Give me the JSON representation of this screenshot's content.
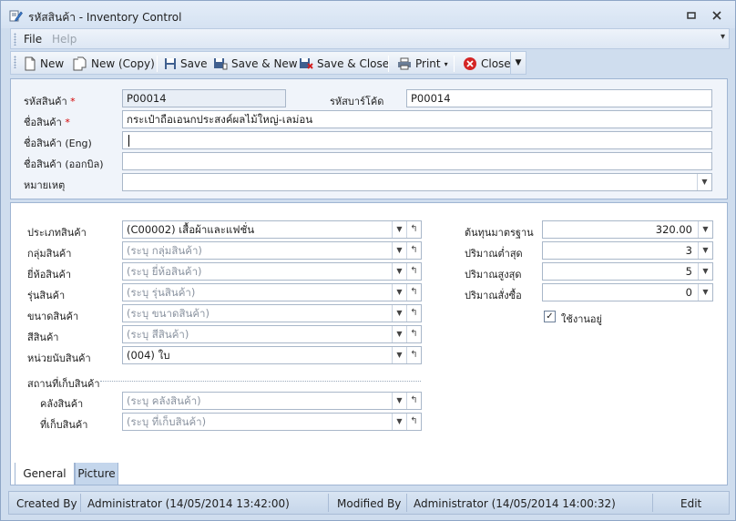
{
  "window": {
    "title": "รหัสสินค้า - Inventory Control",
    "controls": [
      "restore-icon",
      "close-icon"
    ]
  },
  "menu": {
    "file": "File",
    "help": "Help"
  },
  "toolbar": {
    "new": "New",
    "new_copy": "New (Copy)",
    "save": "Save",
    "save_new": "Save & New",
    "save_close": "Save & Close",
    "print": "Print",
    "close": "Close"
  },
  "header_form": {
    "product_code_label": "รหัสสินค้า",
    "product_code": "P00014",
    "barcode_label": "รหัสบาร์โค้ด",
    "barcode": "P00014",
    "product_name_label": "ชื่อสินค้า",
    "product_name": "กระเป๋าถือเอนกประสงค์ผลไม้ใหญ่-เลม่อน",
    "product_name_eng_label": "ชื่อสินค้า (Eng)",
    "product_name_eng": "",
    "product_name_bill_label": "ชื่อสินค้า (ออกบิล)",
    "product_name_bill": "",
    "remark_label": "หมายเหตุ",
    "remark": "",
    "required_mark": "*"
  },
  "general": {
    "category_label": "ประเภทสินค้า",
    "category": "(C00002) เสื้อผ้าและแฟชั่น",
    "group_label": "กลุ่มสินค้า",
    "group_placeholder": "(ระบุ กลุ่มสินค้า)",
    "brand_label": "ยี่ห้อสินค้า",
    "brand_placeholder": "(ระบุ ยี่ห้อสินค้า)",
    "model_label": "รุ่นสินค้า",
    "model_placeholder": "(ระบุ รุ่นสินค้า)",
    "size_label": "ขนาดสินค้า",
    "size_placeholder": "(ระบุ ขนาดสินค้า)",
    "color_label": "สีสินค้า",
    "color_placeholder": "(ระบุ สีสินค้า)",
    "unit_label": "หน่วยนับสินค้า",
    "unit": "(004) ใบ",
    "location_group_label": "สถานที่เก็บสินค้า",
    "warehouse_label": "คลังสินค้า",
    "warehouse_placeholder": "(ระบุ คลังสินค้า)",
    "storage_label": "ที่เก็บสินค้า",
    "storage_placeholder": "(ระบุ ที่เก็บสินค้า)",
    "std_cost_label": "ต้นทุนมาตรฐาน",
    "std_cost": "320.00",
    "min_qty_label": "ปริมาณต่ำสุด",
    "min_qty": "3",
    "max_qty_label": "ปริมาณสูงสุด",
    "max_qty": "5",
    "reorder_qty_label": "ปริมาณสั่งซื้อ",
    "reorder_qty": "0",
    "active_label": "ใช้งานอยู่",
    "active_check": "✓"
  },
  "tabs": {
    "general": "General",
    "picture": "Picture"
  },
  "status": {
    "created_by_label": "Created By",
    "created_by": "Administrator (14/05/2014 13:42:00)",
    "modified_by_label": "Modified By",
    "modified_by": "Administrator (14/05/2014 14:00:32)",
    "mode": "Edit"
  }
}
